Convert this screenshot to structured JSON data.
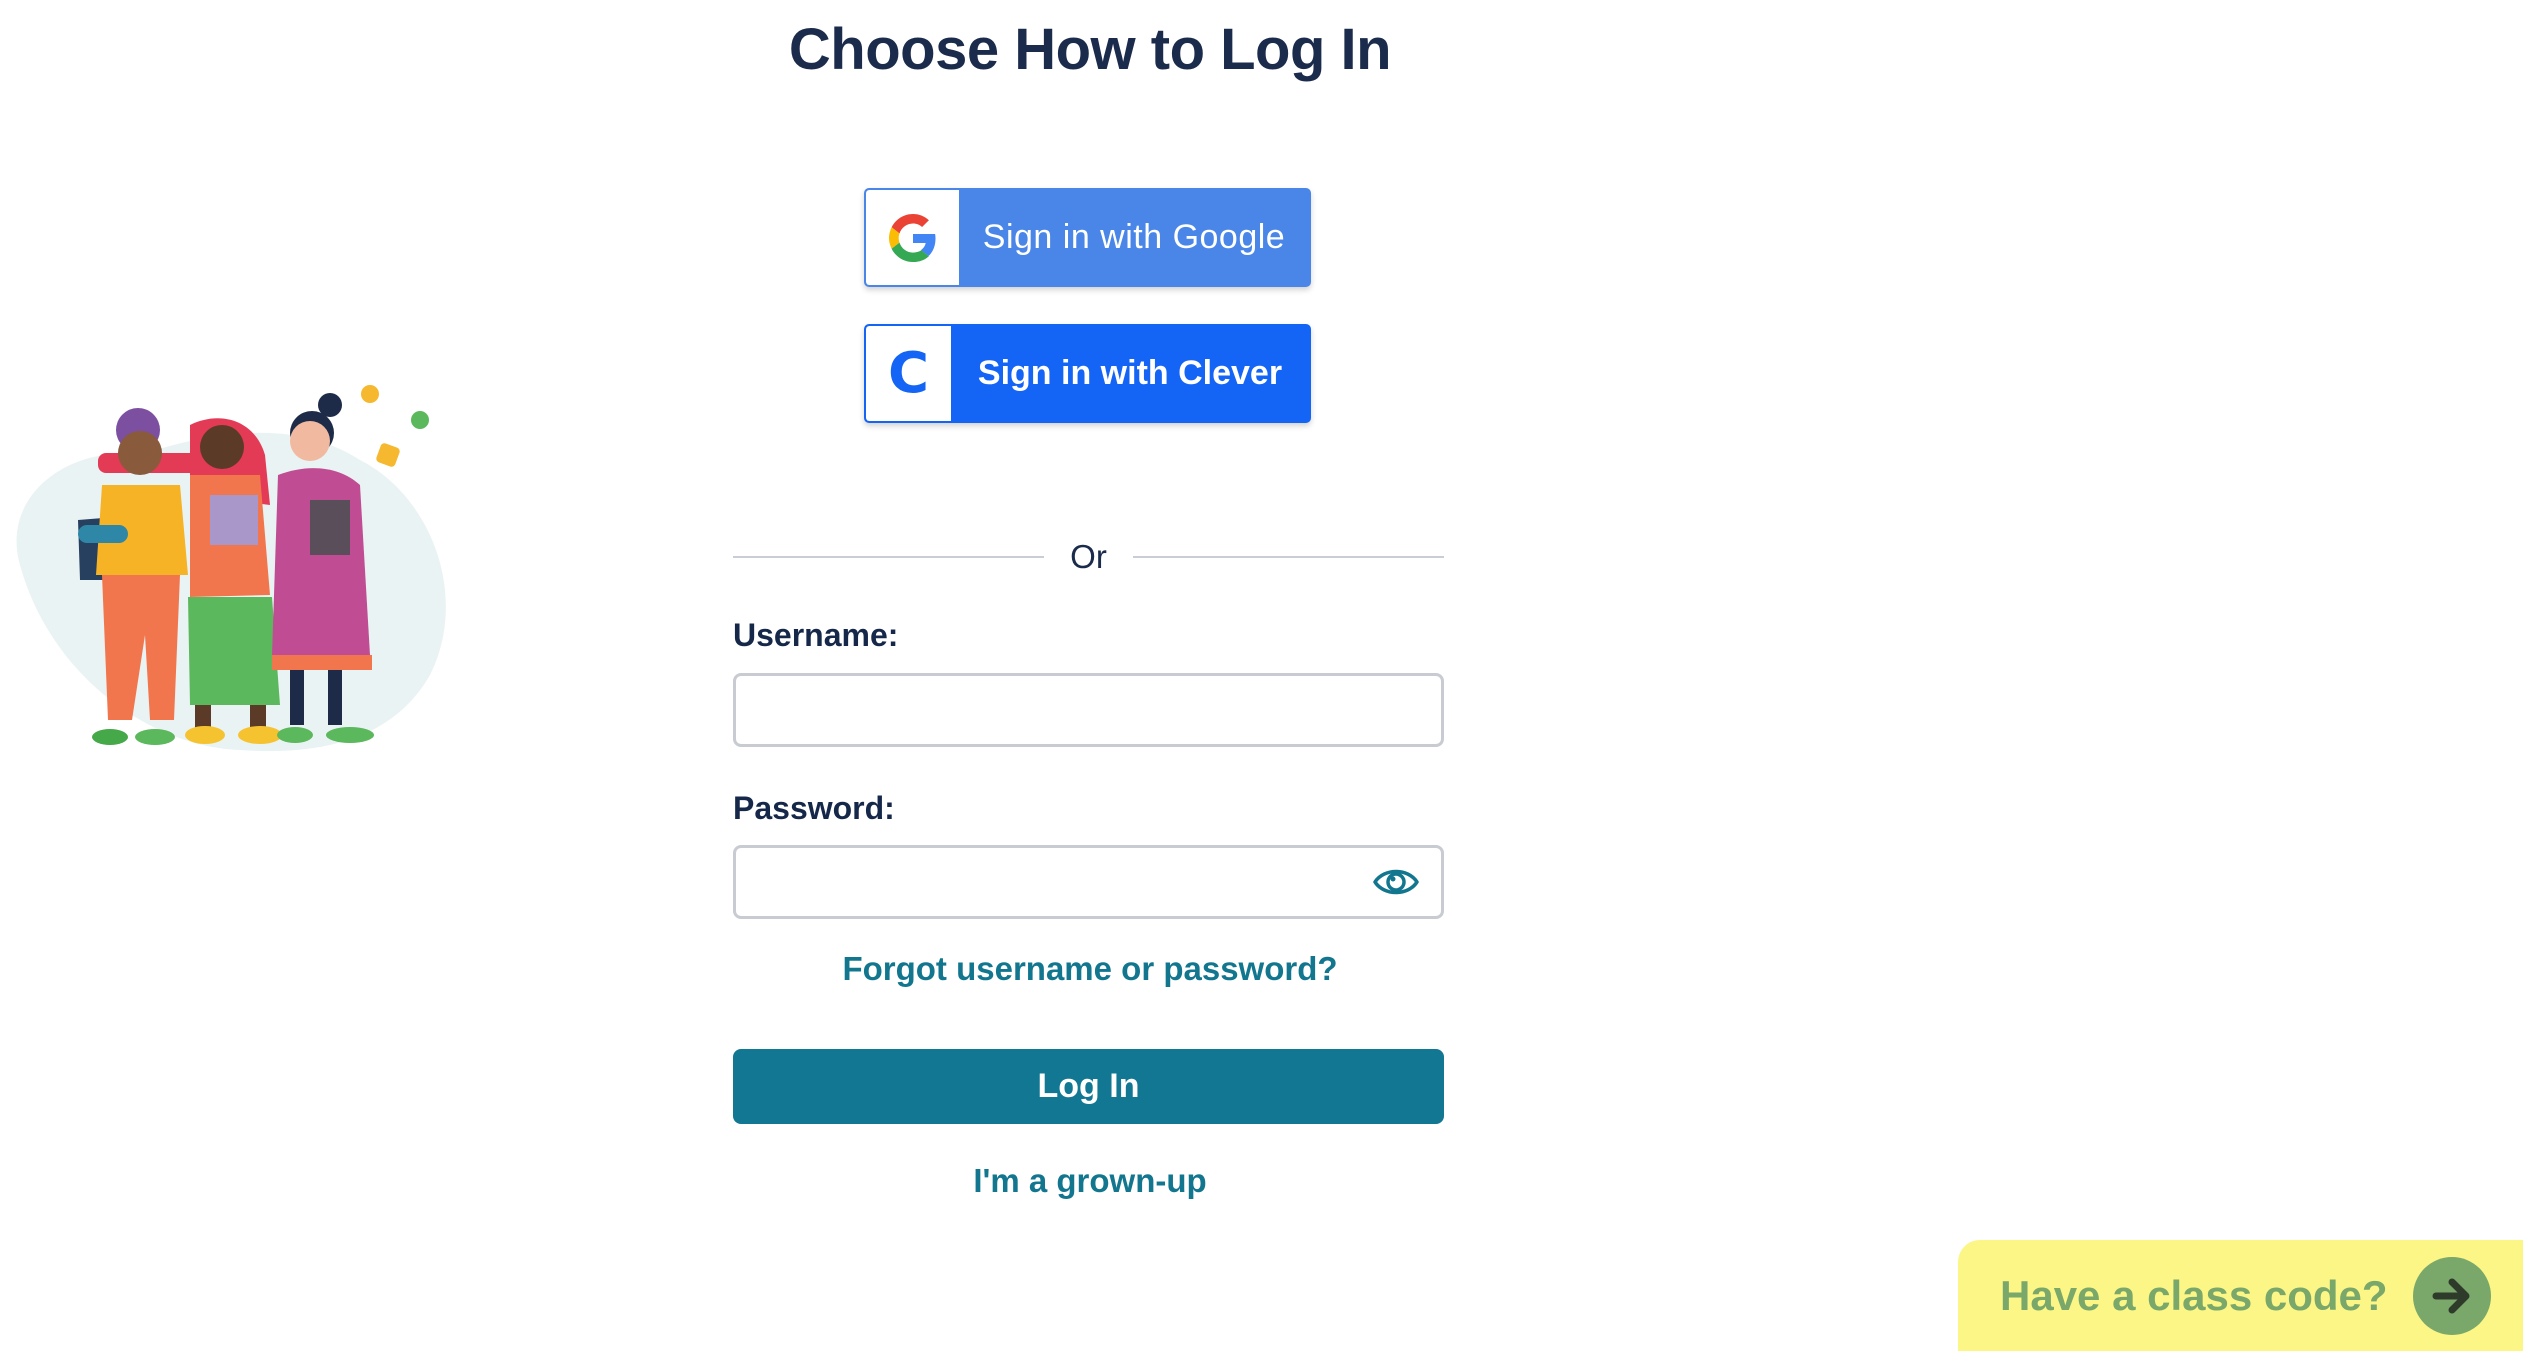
{
  "page": {
    "title": "Choose How to Log In"
  },
  "sso": {
    "google_label": "Sign in with Google",
    "clever_label": "Sign in with Clever",
    "clever_icon_letter": "C"
  },
  "divider_text": "Or",
  "form": {
    "username_label": "Username:",
    "username_value": "",
    "password_label": "Password:",
    "password_value": "",
    "forgot_link": "Forgot username or password?",
    "login_button": "Log In",
    "grownup_link": "I'm a grown-up"
  },
  "class_code": {
    "label": "Have a class code?"
  },
  "icons": {
    "google": "google-g-icon",
    "clever": "clever-c-icon",
    "password_toggle": "eye-icon",
    "class_code_arrow": "arrow-right-icon"
  },
  "colors": {
    "google_blue": "#4a86e8",
    "clever_blue": "#1464f6",
    "primary_teal": "#127792",
    "link_teal": "#13768f",
    "heading_navy": "#1b2b4b",
    "class_code_bg": "#fbf685",
    "class_code_fg": "#7aa76a"
  }
}
